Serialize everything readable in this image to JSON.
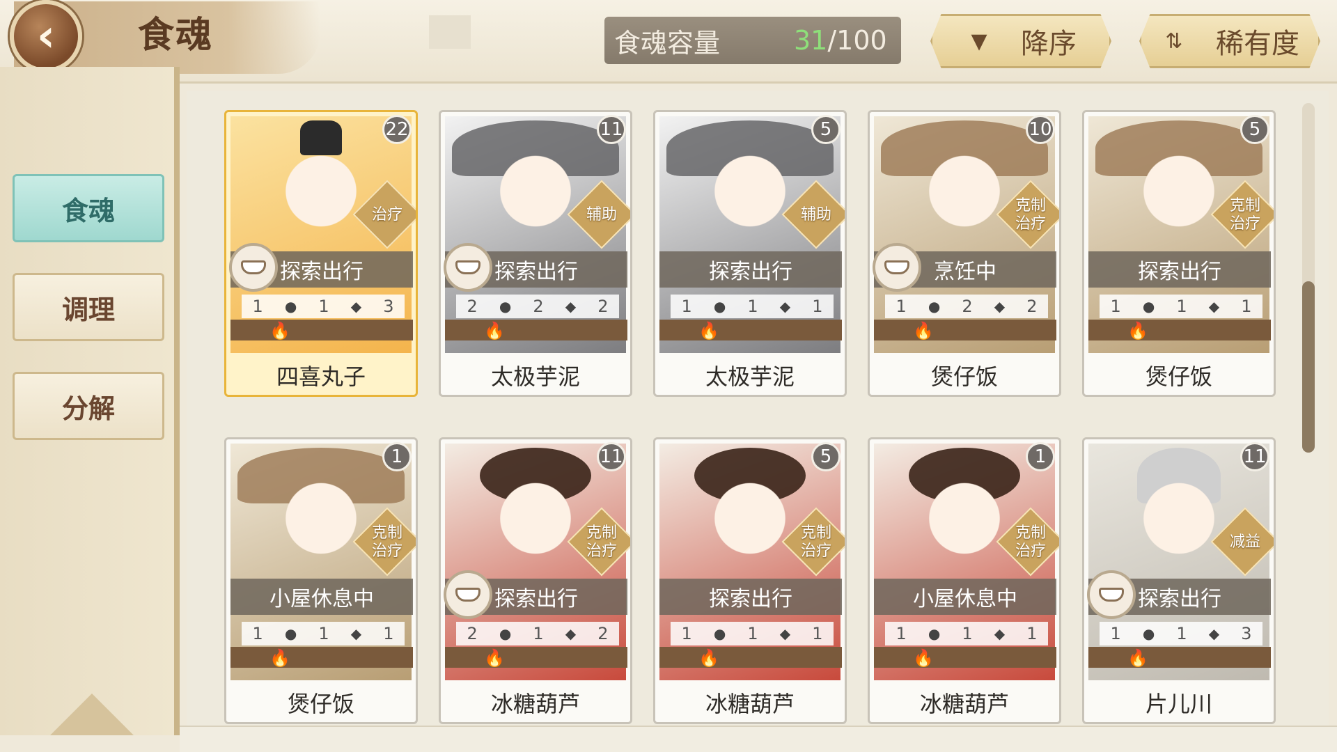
{
  "header": {
    "title": "食魂",
    "capacity_label": "食魂容量",
    "capacity_current": "31",
    "capacity_sep": "/",
    "capacity_max": "100",
    "sort_desc_label": "降序",
    "sort_rarity_label": "稀有度"
  },
  "sidebar": {
    "tabs": [
      {
        "label": "食魂",
        "active": true
      },
      {
        "label": "调理",
        "active": false
      },
      {
        "label": "分解",
        "active": false
      }
    ]
  },
  "cards": [
    {
      "name": "四喜丸子",
      "level": "22",
      "role": "治疗",
      "status": "探索出行",
      "s1": "1",
      "s2": "1",
      "s3": "3",
      "style": "gold"
    },
    {
      "name": "太极芋泥",
      "level": "11",
      "role": "辅助",
      "status": "探索出行",
      "s1": "2",
      "s2": "2",
      "s3": "2",
      "style": "gray"
    },
    {
      "name": "太极芋泥",
      "level": "5",
      "role": "辅助",
      "status": "探索出行",
      "s1": "1",
      "s2": "1",
      "s3": "1",
      "style": "gray"
    },
    {
      "name": "煲仔饭",
      "level": "10",
      "role": "克制\n治疗",
      "status": "烹饪中",
      "s1": "1",
      "s2": "2",
      "s3": "2",
      "style": "teal"
    },
    {
      "name": "煲仔饭",
      "level": "5",
      "role": "克制\n治疗",
      "status": "探索出行",
      "s1": "1",
      "s2": "1",
      "s3": "1",
      "style": "teal"
    },
    {
      "name": "煲仔饭",
      "level": "1",
      "role": "克制\n治疗",
      "status": "小屋休息中",
      "s1": "1",
      "s2": "1",
      "s3": "1",
      "style": "teal"
    },
    {
      "name": "冰糖葫芦",
      "level": "11",
      "role": "克制\n治疗",
      "status": "探索出行",
      "s1": "2",
      "s2": "1",
      "s3": "2",
      "style": "red"
    },
    {
      "name": "冰糖葫芦",
      "level": "5",
      "role": "克制\n治疗",
      "status": "探索出行",
      "s1": "1",
      "s2": "1",
      "s3": "1",
      "style": "red"
    },
    {
      "name": "冰糖葫芦",
      "level": "1",
      "role": "克制\n治疗",
      "status": "小屋休息中",
      "s1": "1",
      "s2": "1",
      "s3": "1",
      "style": "red"
    },
    {
      "name": "片儿川",
      "level": "11",
      "role": "减益",
      "status": "探索出行",
      "s1": "1",
      "s2": "1",
      "s3": "3",
      "style": "white"
    }
  ],
  "icons": {
    "back": "chevron-left-icon",
    "sort_desc": "triangle-down-icon",
    "sort_rarity": "swap-icon",
    "status": "bowl-icon",
    "stat": "droplet-icon",
    "flame": "flame-icon"
  },
  "colors": {
    "accent": "#9fd8cf",
    "capacity_current": "#8ee07a",
    "gold_border": "#e8b43a"
  }
}
